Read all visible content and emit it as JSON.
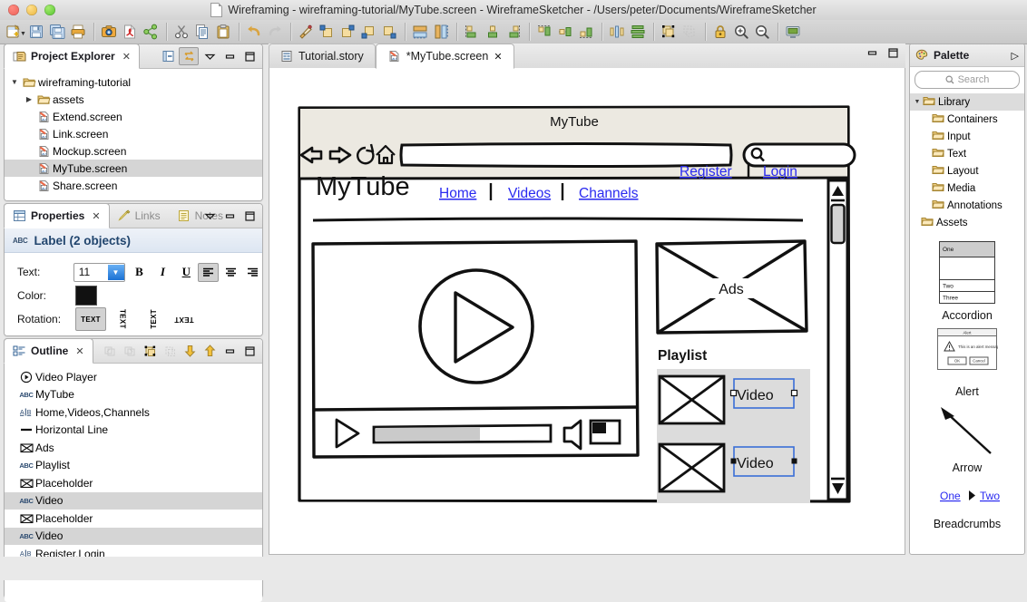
{
  "window": {
    "title": "Wireframing - wireframing-tutorial/MyTube.screen - WireframeSketcher - /Users/peter/Documents/WireframeSketcher"
  },
  "toolbar": {
    "groups": [
      {
        "buttons": [
          {
            "name": "new-file-icon",
            "label": "New"
          },
          {
            "name": "save-icon",
            "label": "Save"
          },
          {
            "name": "save-all-icon",
            "label": "Save All"
          },
          {
            "name": "print-icon",
            "label": "Print"
          }
        ]
      },
      {
        "buttons": [
          {
            "name": "export-image-icon",
            "label": "Export as Image"
          },
          {
            "name": "export-pdf-icon",
            "label": "Export as PDF"
          },
          {
            "name": "share-icon",
            "label": "Share"
          }
        ]
      },
      {
        "buttons": [
          {
            "name": "cut-icon",
            "label": "Cut"
          },
          {
            "name": "copy-icon",
            "label": "Copy"
          },
          {
            "name": "paste-icon",
            "label": "Paste"
          }
        ]
      },
      {
        "buttons": [
          {
            "name": "undo-icon",
            "label": "Undo"
          },
          {
            "name": "redo-icon",
            "label": "Redo"
          }
        ]
      },
      {
        "buttons": [
          {
            "name": "format-painter-icon",
            "label": "Format Painter"
          },
          {
            "name": "bring-to-front-icon",
            "label": "Bring to Front"
          },
          {
            "name": "bring-forward-icon",
            "label": "Bring Forward"
          },
          {
            "name": "send-backward-icon",
            "label": "Send Backward"
          },
          {
            "name": "send-to-back-icon",
            "label": "Send to Back"
          }
        ]
      },
      {
        "buttons": [
          {
            "name": "match-width-icon",
            "label": "Match Width"
          },
          {
            "name": "match-height-icon",
            "label": "Match Height"
          }
        ]
      },
      {
        "buttons": [
          {
            "name": "align-left-icon",
            "label": "Align Left"
          },
          {
            "name": "align-center-icon",
            "label": "Align Center"
          },
          {
            "name": "align-right-icon",
            "label": "Align Right"
          }
        ]
      },
      {
        "buttons": [
          {
            "name": "align-top-icon",
            "label": "Align Top"
          },
          {
            "name": "align-middle-icon",
            "label": "Align Middle"
          },
          {
            "name": "align-bottom-icon",
            "label": "Align Bottom"
          }
        ]
      },
      {
        "buttons": [
          {
            "name": "distribute-horizontal-icon",
            "label": "Distribute Horizontally"
          },
          {
            "name": "distribute-vertical-icon",
            "label": "Distribute Vertically"
          }
        ]
      },
      {
        "buttons": [
          {
            "name": "group-icon",
            "label": "Group"
          },
          {
            "name": "ungroup-icon",
            "label": "Ungroup"
          }
        ]
      },
      {
        "buttons": [
          {
            "name": "lock-icon",
            "label": "Lock"
          },
          {
            "name": "zoom-in-icon",
            "label": "Zoom In"
          },
          {
            "name": "zoom-out-icon",
            "label": "Zoom Out"
          }
        ]
      },
      {
        "buttons": [
          {
            "name": "presentation-icon",
            "label": "Presentation Mode"
          }
        ]
      }
    ]
  },
  "project_explorer": {
    "title": "Project Explorer",
    "toolbar": [
      {
        "name": "collapse-all-icon",
        "label": "Collapse All",
        "pressed": false
      },
      {
        "name": "link-with-editor-icon",
        "label": "Link with Editor",
        "pressed": true
      },
      {
        "name": "view-menu-icon",
        "label": "View Menu",
        "pressed": false
      },
      {
        "name": "minimize-icon",
        "label": "Minimize",
        "pressed": false
      },
      {
        "name": "maximize-icon",
        "label": "Maximize",
        "pressed": false
      }
    ],
    "tree": [
      {
        "label": "wireframing-tutorial",
        "indent": 0,
        "twisty": "down",
        "icon": "folder-open-icon",
        "selected": false
      },
      {
        "label": "assets",
        "indent": 1,
        "twisty": "right",
        "icon": "folder-icon",
        "selected": false
      },
      {
        "label": "Extend.screen",
        "indent": 2,
        "twisty": "",
        "icon": "screen-file-icon",
        "selected": false
      },
      {
        "label": "Link.screen",
        "indent": 2,
        "twisty": "",
        "icon": "screen-file-icon",
        "selected": false
      },
      {
        "label": "Mockup.screen",
        "indent": 2,
        "twisty": "",
        "icon": "screen-file-icon",
        "selected": false
      },
      {
        "label": "MyTube.screen",
        "indent": 2,
        "twisty": "",
        "icon": "screen-file-icon",
        "selected": true
      },
      {
        "label": "Share.screen",
        "indent": 2,
        "twisty": "",
        "icon": "screen-file-icon",
        "selected": false
      }
    ]
  },
  "properties": {
    "tabs": [
      {
        "label": "Properties",
        "active": true,
        "icon": "properties-icon",
        "closable": true
      },
      {
        "label": "Links",
        "active": false,
        "icon": "links-icon",
        "closable": false
      },
      {
        "label": "Notes",
        "active": false,
        "icon": "notes-icon",
        "closable": false
      }
    ],
    "toolbar": [
      {
        "name": "view-menu-icon",
        "label": "View Menu"
      },
      {
        "name": "minimize-icon",
        "label": "Minimize"
      },
      {
        "name": "maximize-icon",
        "label": "Maximize"
      }
    ],
    "header": "Label (2 objects",
    "header_full": "Label (2 objects)",
    "rows": {
      "text_label": "Text:",
      "font_size": "11",
      "bold": "B",
      "italic": "I",
      "underline": "U",
      "align_left": "align-left",
      "align_center": "align-center",
      "align_right": "align-right",
      "color_label": "Color:",
      "color_value": "#111111",
      "rotation_label": "Rotation:",
      "rotation_options": [
        "TEXT",
        "TEXT",
        "TEXT",
        "TEXT"
      ]
    }
  },
  "outline": {
    "title": "Outline",
    "toolbar": [
      {
        "name": "enter-group-icon",
        "label": "Enter Group",
        "disabled": true
      },
      {
        "name": "exit-group-icon",
        "label": "Exit Group",
        "disabled": true
      },
      {
        "name": "group-icon",
        "label": "Group",
        "disabled": false
      },
      {
        "name": "ungroup-icon",
        "label": "Ungroup",
        "disabled": true
      },
      {
        "name": "move-down-icon",
        "label": "Move Down",
        "disabled": false
      },
      {
        "name": "move-up-icon",
        "label": "Move Up",
        "disabled": false
      },
      {
        "name": "minimize-icon",
        "label": "Minimize",
        "disabled": false
      },
      {
        "name": "maximize-icon",
        "label": "Maximize",
        "disabled": false
      }
    ],
    "items": [
      {
        "label": "Video Player",
        "icon": "video-player-icon",
        "selected": false
      },
      {
        "label": "MyTube",
        "icon": "label-icon",
        "selected": false
      },
      {
        "label": "Home,Videos,Channels",
        "icon": "link-bar-icon",
        "selected": false
      },
      {
        "label": "Horizontal Line",
        "icon": "horizontal-line-icon",
        "selected": false
      },
      {
        "label": "Ads",
        "icon": "placeholder-icon",
        "selected": false
      },
      {
        "label": "Playlist",
        "icon": "label-icon",
        "selected": false
      },
      {
        "label": "Placeholder",
        "icon": "placeholder-icon",
        "selected": false
      },
      {
        "label": "Video",
        "icon": "label-icon",
        "selected": true
      },
      {
        "label": "Placeholder",
        "icon": "placeholder-icon",
        "selected": false
      },
      {
        "label": "Video",
        "icon": "label-icon",
        "selected": true
      },
      {
        "label": "Register,Login",
        "icon": "link-bar-icon",
        "selected": false
      }
    ]
  },
  "editor": {
    "tabs": [
      {
        "label": "Tutorial.story",
        "active": false,
        "icon": "story-file-icon",
        "closable": false
      },
      {
        "label": "*MyTube.screen",
        "active": true,
        "icon": "screen-file-icon",
        "closable": true
      }
    ],
    "window_buttons": [
      {
        "name": "minimize-icon",
        "label": "Minimize"
      },
      {
        "name": "maximize-icon",
        "label": "Maximize"
      }
    ]
  },
  "wireframe": {
    "browser_title": "MyTube",
    "nav_icons": [
      "back-arrow-icon",
      "forward-arrow-icon",
      "reload-icon",
      "home-icon"
    ],
    "address_bar_value": "",
    "search_box_value": "",
    "site": {
      "logo": "MyTube",
      "nav_links": [
        "Home",
        "Videos",
        "Channels"
      ],
      "auth_links": [
        "Register",
        "Login"
      ],
      "ads_label": "Ads",
      "playlist_label": "Playlist",
      "playlist_items": [
        {
          "label": "Video",
          "selected": true
        },
        {
          "label": "Video",
          "selected": true
        }
      ],
      "player": {
        "progress_percent": 60,
        "controls": [
          "play-icon",
          "progress-bar",
          "volume-icon",
          "fullscreen-icon"
        ]
      }
    },
    "scrollbar": {
      "thumb_top_percent": 4,
      "thumb_height_percent": 14
    }
  },
  "palette": {
    "title": "Palette",
    "pin_icon": "pin-icon",
    "search_placeholder": "Search",
    "search_value": "",
    "tree": [
      {
        "label": "Library",
        "indent": 0,
        "twisty": "down",
        "selected": true
      },
      {
        "label": "Containers",
        "indent": 1,
        "twisty": "",
        "selected": false
      },
      {
        "label": "Input",
        "indent": 1,
        "twisty": "",
        "selected": false
      },
      {
        "label": "Text",
        "indent": 1,
        "twisty": "",
        "selected": false
      },
      {
        "label": "Layout",
        "indent": 1,
        "twisty": "",
        "selected": false
      },
      {
        "label": "Media",
        "indent": 1,
        "twisty": "",
        "selected": false
      },
      {
        "label": "Annotations",
        "indent": 1,
        "twisty": "",
        "selected": false
      },
      {
        "label": "Assets",
        "indent": 0,
        "twisty": "",
        "selected": false
      }
    ],
    "items": [
      {
        "caption": "Accordion",
        "preview_rows": [
          "One",
          "Two",
          "Three"
        ]
      },
      {
        "caption": "Alert",
        "preview_title": "Alert",
        "preview_message": "This is an alert message",
        "preview_buttons": [
          "OK",
          "Cancel"
        ]
      },
      {
        "caption": "Arrow"
      },
      {
        "caption": "Breadcrumbs",
        "preview_links": [
          "One",
          "Two"
        ]
      }
    ]
  }
}
